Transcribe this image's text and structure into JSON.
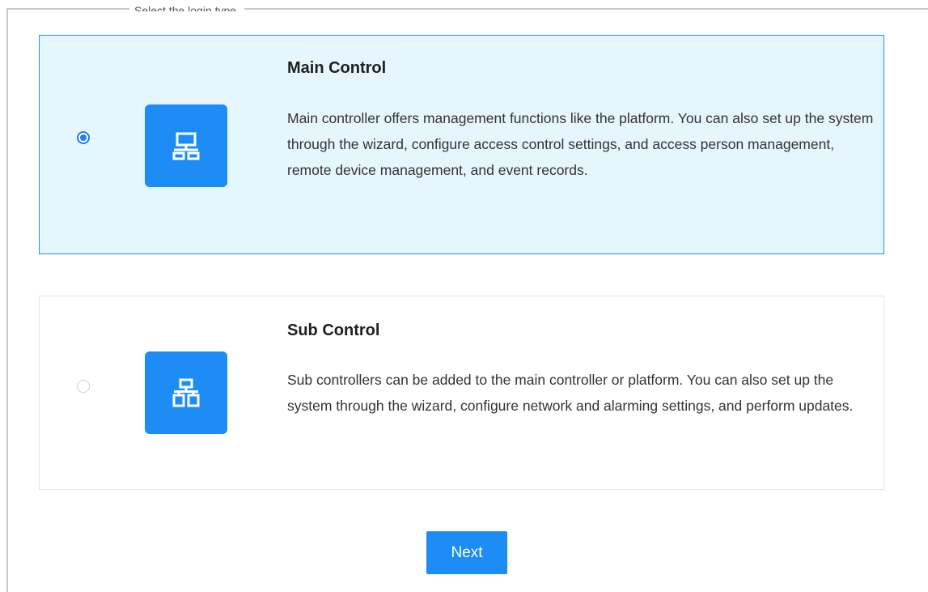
{
  "header": {
    "caption": "Select the login type."
  },
  "options": [
    {
      "id": "main",
      "title": "Main Control",
      "description": "Main controller offers management functions like the platform. You can also set up the system through the wizard, configure access control settings, and access person management, remote device management, and event records.",
      "selected": true,
      "icon": "network-topology-icon"
    },
    {
      "id": "sub",
      "title": "Sub Control",
      "description": "Sub controllers can be added to the main controller or platform. You can also set up the system through the wizard, configure network and alarming settings, and perform updates.",
      "selected": false,
      "icon": "hierarchy-icon"
    }
  ],
  "actions": {
    "next_label": "Next"
  },
  "colors": {
    "accent": "#1e8cf5",
    "selected_background": "#e6f6fd",
    "selected_border": "#1e90ff",
    "card_border": "#e6e6e6"
  }
}
